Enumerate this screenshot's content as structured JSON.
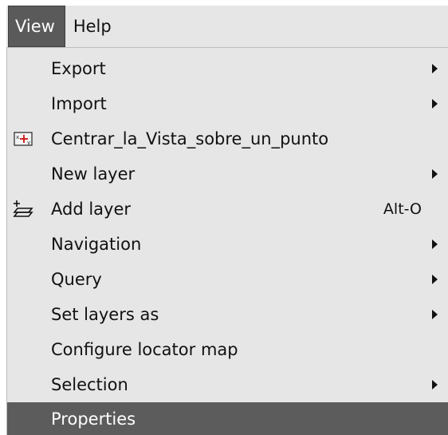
{
  "menubar": {
    "items": [
      {
        "label": "View",
        "active": true
      },
      {
        "label": "Help",
        "active": false
      }
    ]
  },
  "dropdown": {
    "items": [
      {
        "label": "Export",
        "submenu": true
      },
      {
        "label": "Import",
        "submenu": true
      },
      {
        "label": "Centrar_la_Vista_sobre_un_punto",
        "icon": "center-on-point-icon"
      },
      {
        "label": "New layer",
        "submenu": true
      },
      {
        "label": "Add layer",
        "icon": "add-layer-icon",
        "accelerator": "Alt-O"
      },
      {
        "label": "Navigation",
        "submenu": true
      },
      {
        "label": "Query",
        "submenu": true
      },
      {
        "label": "Set layers as",
        "submenu": true
      },
      {
        "label": "Configure locator map"
      },
      {
        "label": "Selection",
        "submenu": true
      },
      {
        "label": "Properties",
        "highlighted": true
      }
    ]
  },
  "colors": {
    "menu_background": "#e6e6e6",
    "highlight_background": "#5c5c5c",
    "highlight_text": "#ffffff",
    "text": "#111111",
    "icon_accent": "#cc1111"
  }
}
